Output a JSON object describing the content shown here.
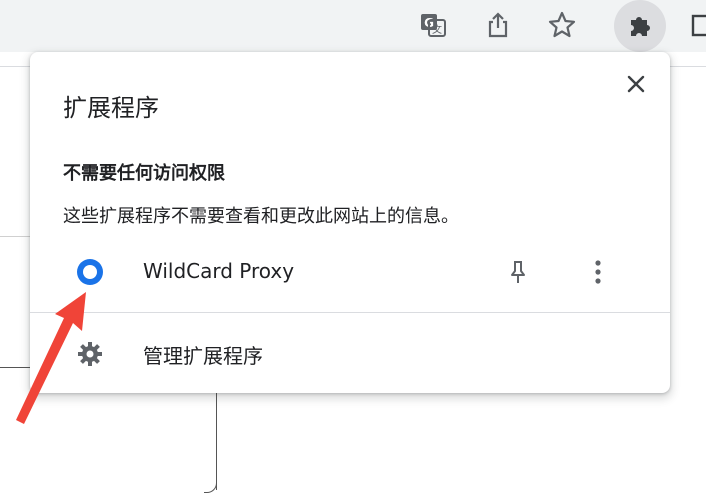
{
  "toolbar": {
    "icons": [
      "translate-icon",
      "share-icon",
      "bookmark-star-icon",
      "extensions-puzzle-icon",
      "side-panel-icon"
    ]
  },
  "popup": {
    "title": "扩展程序",
    "close_icon": "close-icon",
    "section_heading": "不需要任何访问权限",
    "section_desc": "这些扩展程序不需要查看和更改此网站上的信息。",
    "extension": {
      "name": "WildCard Proxy",
      "icon": "wildcard-proxy-icon",
      "icon_color": "#1a73e8"
    },
    "manage_label": "管理扩展程序"
  },
  "annotation": {
    "arrow_color": "#f04438"
  }
}
